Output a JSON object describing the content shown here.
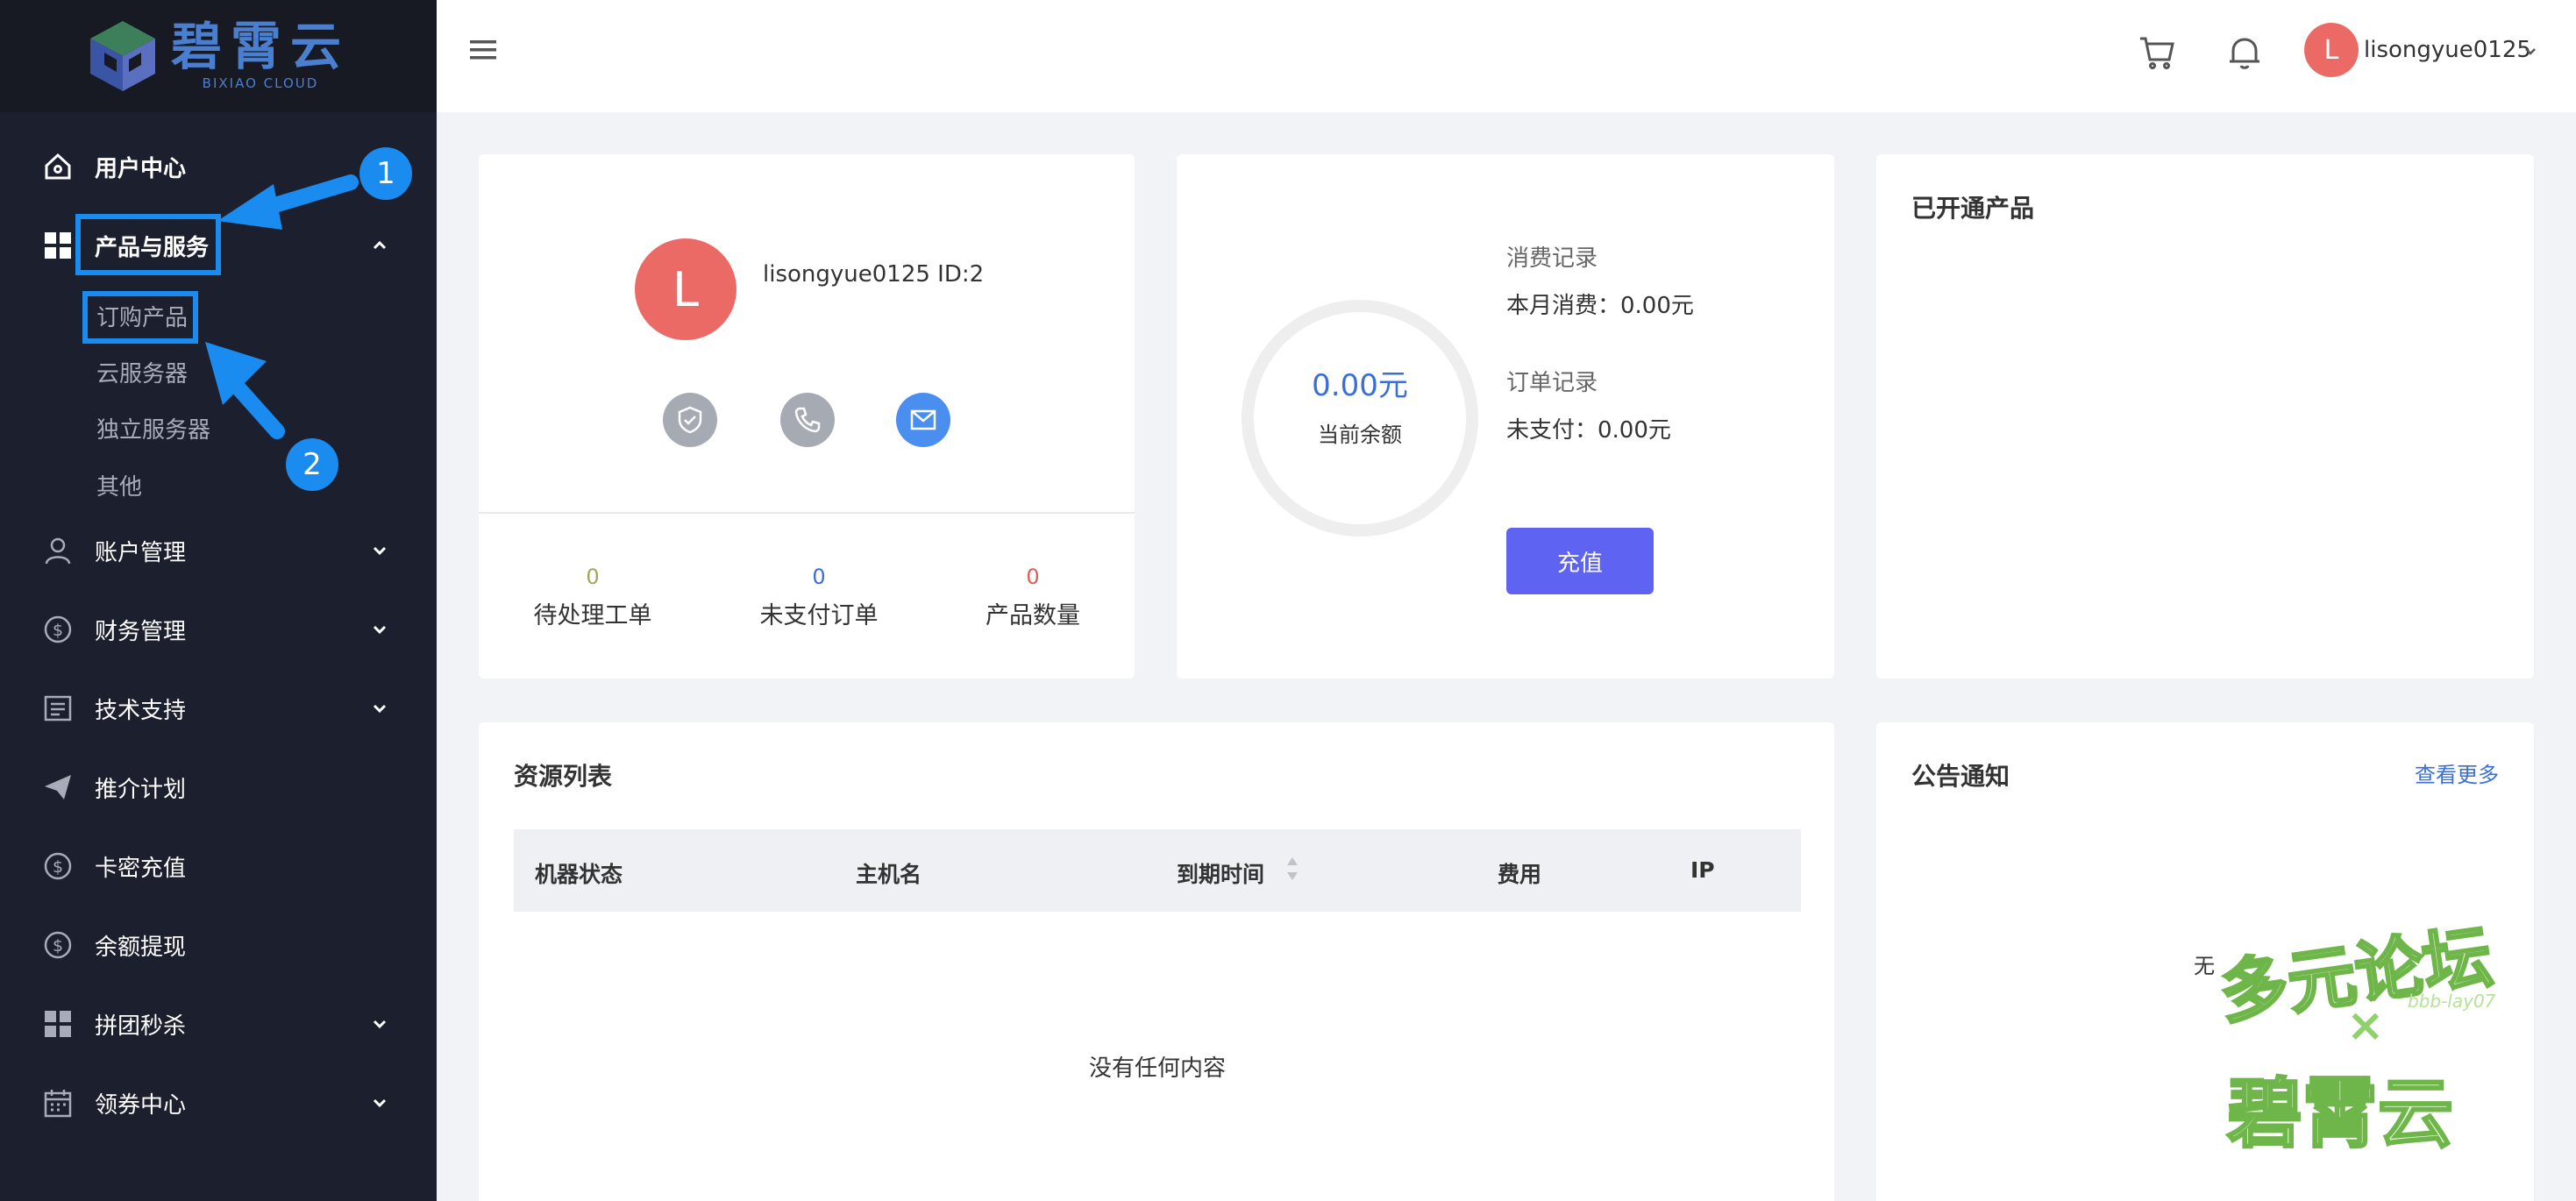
{
  "brand": {
    "name_cn": "碧霄云",
    "name_en": "BIXIAO CLOUD"
  },
  "sidebar": {
    "items": [
      {
        "label": "用户中心",
        "icon": "home-icon"
      },
      {
        "label": "产品与服务",
        "icon": "grid-icon",
        "expanded": true
      },
      {
        "label": "账户管理",
        "icon": "user-icon"
      },
      {
        "label": "财务管理",
        "icon": "dollar-icon"
      },
      {
        "label": "技术支持",
        "icon": "document-icon"
      },
      {
        "label": "推介计划",
        "icon": "paper-plane-icon"
      },
      {
        "label": "卡密充值",
        "icon": "dollar-icon"
      },
      {
        "label": "余额提现",
        "icon": "dollar-icon"
      },
      {
        "label": "拼团秒杀",
        "icon": "grid-icon"
      },
      {
        "label": "领券中心",
        "icon": "calendar-icon"
      }
    ],
    "sub_items": [
      "订购产品",
      "云服务器",
      "独立服务器",
      "其他"
    ],
    "annotations": [
      "1",
      "2"
    ],
    "highlight_color": "#1a8cf0"
  },
  "header": {
    "username": "lisongyue0125",
    "avatar_letter": "L"
  },
  "profile": {
    "avatar_letter": "L",
    "name_id": "lisongyue0125 ID:2",
    "stats": [
      {
        "value": "0",
        "label": "待处理工单",
        "color": "#a3a65a"
      },
      {
        "value": "0",
        "label": "未支付订单",
        "color": "#3a6fd8"
      },
      {
        "value": "0",
        "label": "产品数量",
        "color": "#e25a5a"
      }
    ]
  },
  "balance": {
    "amount": "0.00元",
    "label": "当前余额",
    "consume_title": "消费记录",
    "consume_value": "本月消费：0.00元",
    "order_title": "订单记录",
    "order_value": "未支付：0.00元",
    "recharge_button": "充值"
  },
  "products": {
    "title": "已开通产品"
  },
  "resources": {
    "title": "资源列表",
    "columns": [
      "机器状态",
      "主机名",
      "到期时间",
      "费用",
      "IP"
    ],
    "empty_text": "没有任何内容"
  },
  "notices": {
    "title": "公告通知",
    "more_link": "查看更多",
    "partial_text": "无"
  },
  "watermark": {
    "line1": "多元论坛",
    "cross": "×",
    "line2": "碧霄云",
    "small": "bbb-lay07"
  },
  "colors": {
    "sidebar_bg": "#1c1f2d",
    "accent": "#5f63f2",
    "avatar": "#ec6a66"
  }
}
